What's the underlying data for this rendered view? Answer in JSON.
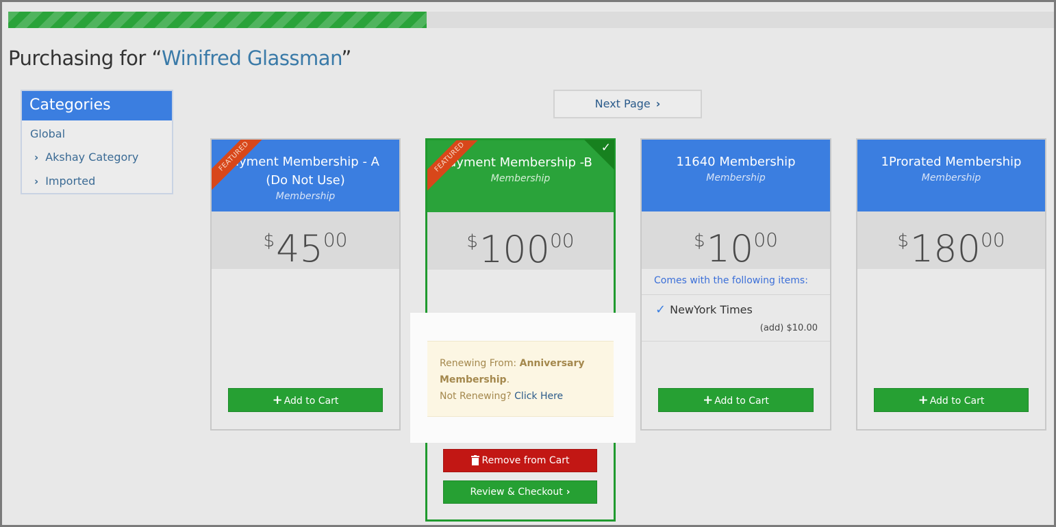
{
  "progress": {
    "percent": 40
  },
  "header": {
    "prefix": "Purchasing for “",
    "customer": "Winifred Glassman",
    "suffix": "”"
  },
  "sidebar": {
    "title": "Categories",
    "items": [
      {
        "label": "Global"
      },
      {
        "label": "Akshay Category"
      },
      {
        "label": "Imported"
      }
    ]
  },
  "pagination": {
    "next_label": "Next Page"
  },
  "cards": [
    {
      "title_line1": "ayment Membership - A",
      "title_line2": "(Do Not Use)",
      "subtitle": "Membership",
      "price_currency": "$",
      "price_dollars": "45",
      "price_cents": "00",
      "ribbon": "FEATURED",
      "button": "Add to Cart"
    },
    {
      "title_line1": "ayment Membership -B",
      "subtitle": "Membership",
      "price_currency": "$",
      "price_dollars": "100",
      "price_cents": "00",
      "ribbon": "FEATURED",
      "renew_prefix": "Renewing From: ",
      "renew_from": "Anniversary Membership",
      "renew_suffix": ".",
      "not_renewing": "Not Renewing? ",
      "click_here": "Click Here",
      "remove_button": "Remove from Cart",
      "checkout_button": "Review & Checkout"
    },
    {
      "title_line1": "11640 Membership",
      "subtitle": "Membership",
      "price_currency": "$",
      "price_dollars": "10",
      "price_cents": "00",
      "items_caption": "Comes with the following items:",
      "item_name": "NewYork Times",
      "item_price": "(add) $10.00",
      "button": "Add to Cart"
    },
    {
      "title_line1": "1Prorated Membership",
      "subtitle": "Membership",
      "price_currency": "$",
      "price_dollars": "180",
      "price_cents": "00",
      "button": "Add to Cart"
    }
  ],
  "colors": {
    "accent_blue": "#3b7ee0",
    "selected_green": "#2aa33a",
    "remove_red": "#c21714",
    "ribbon_orange": "#d8471a",
    "renew_background": "#fcf6e3"
  },
  "icons": [
    "chevron-right-icon",
    "plus-icon",
    "trash-icon",
    "checkmark-icon"
  ]
}
